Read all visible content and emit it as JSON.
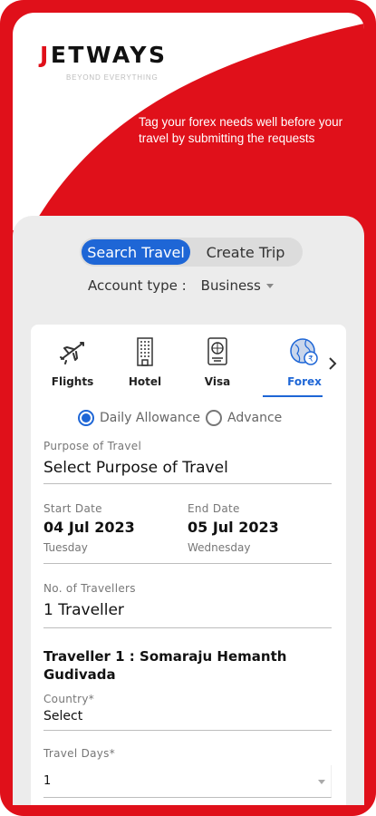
{
  "brand": {
    "logo_j": "J",
    "logo_rest": "ETWAYS",
    "tagline": "BEYOND EVERYTHING",
    "promo": "Tag your forex needs well before your travel by submitting the requests"
  },
  "mode_toggle": {
    "active": "Search Travel",
    "inactive": "Create Trip"
  },
  "account": {
    "label": "Account type :",
    "value": "Business"
  },
  "tabs": [
    {
      "label": "Flights",
      "icon": "plane-icon"
    },
    {
      "label": "Hotel",
      "icon": "building-icon"
    },
    {
      "label": "Visa",
      "icon": "passport-icon"
    },
    {
      "label": "Forex",
      "icon": "currency-globe-icon"
    }
  ],
  "active_tab": "Forex",
  "forex_type": {
    "option1": "Daily Allowance",
    "option2": "Advance",
    "selected": "Daily Allowance"
  },
  "form": {
    "purpose_label": "Purpose of Travel",
    "purpose_value": "Select Purpose of Travel",
    "start_label": "Start Date",
    "start_value": "04 Jul 2023",
    "start_day": "Tuesday",
    "end_label": "End Date",
    "end_value": "05 Jul 2023",
    "end_day": "Wednesday",
    "travellers_label": "No. of Travellers",
    "travellers_value": "1 Traveller",
    "traveller_heading": "Traveller 1 : Somaraju Hemanth Gudivada",
    "country_label": "Country*",
    "country_value": "Select",
    "days_label": "Travel Days*",
    "days_value": "1"
  },
  "colors": {
    "brand_red": "#e0101a",
    "accent_blue": "#1e66d6",
    "panel_gray": "#ececec"
  }
}
